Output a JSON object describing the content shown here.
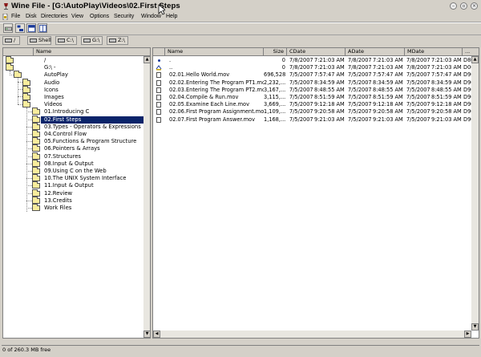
{
  "window": {
    "title": "Wine File - [G:\\AutoPlay\\Videos\\02.First Steps"
  },
  "menu": [
    "File",
    "Disk",
    "Directories",
    "View",
    "Options",
    "Security",
    "Window",
    "Help"
  ],
  "drives": [
    "/",
    "Shell",
    "C:\\",
    "G:\\",
    "Z:\\"
  ],
  "tree": {
    "header": "Name",
    "items": [
      {
        "label": "/",
        "level": 0
      },
      {
        "label": "G:\\ -",
        "level": 0
      },
      {
        "label": "AutoPlay",
        "level": 1
      },
      {
        "label": "Audio",
        "level": 2
      },
      {
        "label": "Icons",
        "level": 2
      },
      {
        "label": "Images",
        "level": 2
      },
      {
        "label": "Videos",
        "level": 2
      },
      {
        "label": "01.Introducing C",
        "level": 3
      },
      {
        "label": "02.First Steps",
        "level": 3,
        "selected": true
      },
      {
        "label": "03.Types - Operators & Expressions",
        "level": 3
      },
      {
        "label": "04.Control Flow",
        "level": 3
      },
      {
        "label": "05.Functions & Program Structure",
        "level": 3
      },
      {
        "label": "06.Pointers & Arrays",
        "level": 3
      },
      {
        "label": "07.Structures",
        "level": 3
      },
      {
        "label": "08.Input & Output",
        "level": 3
      },
      {
        "label": "09.Using C on the Web",
        "level": 3
      },
      {
        "label": "10.The UNIX System Interface",
        "level": 3
      },
      {
        "label": "11.Input & Output",
        "level": 3
      },
      {
        "label": "12.Review",
        "level": 3
      },
      {
        "label": "13.Credits",
        "level": 3
      },
      {
        "label": "Work Files",
        "level": 3
      }
    ]
  },
  "files": {
    "headers": {
      "name": "Name",
      "size": "Size",
      "cdate": "CDate",
      "adate": "ADate",
      "mdate": "MDate",
      "more": "..."
    },
    "rows": [
      {
        "icon": "dot",
        "name": ".",
        "size": "0",
        "cdate": "7/8/2007",
        "ctime": "7:21:03 AM",
        "adate": "7/8/2007",
        "atime": "7:21:03 AM",
        "mdate": "7/8/2007",
        "mtime": "7:21:03 AM",
        "attr": "D80"
      },
      {
        "icon": "up",
        "name": "..",
        "size": "0",
        "cdate": "7/8/2007",
        "ctime": "7:21:03 AM",
        "adate": "7/8/2007",
        "atime": "7:21:03 AM",
        "mdate": "7/8/2007",
        "mtime": "7:21:03 AM",
        "attr": "D00"
      },
      {
        "icon": "file",
        "name": "02.01.Hello World.mov",
        "size": "696,528",
        "cdate": "7/5/2007",
        "ctime": "7:57:47 AM",
        "adate": "7/5/2007",
        "atime": "7:57:47 AM",
        "mdate": "7/5/2007",
        "mtime": "7:57:47 AM",
        "attr": "D90"
      },
      {
        "icon": "file",
        "name": "02.02.Entering The Program PT1.mov",
        "size": "2,232,...",
        "cdate": "7/5/2007",
        "ctime": "8:34:59 AM",
        "adate": "7/5/2007",
        "atime": "8:34:59 AM",
        "mdate": "7/5/2007",
        "mtime": "8:34:59 AM",
        "attr": "D90"
      },
      {
        "icon": "file",
        "name": "02.03.Entering The Program PT2.mov",
        "size": "3,167,...",
        "cdate": "7/5/2007",
        "ctime": "8:48:55 AM",
        "adate": "7/5/2007",
        "atime": "8:48:55 AM",
        "mdate": "7/5/2007",
        "mtime": "8:48:55 AM",
        "attr": "D90"
      },
      {
        "icon": "file",
        "name": "02.04.Compile & Run.mov",
        "size": "3,115,...",
        "cdate": "7/5/2007",
        "ctime": "8:51:59 AM",
        "adate": "7/5/2007",
        "atime": "8:51:59 AM",
        "mdate": "7/5/2007",
        "mtime": "8:51:59 AM",
        "attr": "D90"
      },
      {
        "icon": "file",
        "name": "02.05.Examine Each Line.mov",
        "size": "3,669,...",
        "cdate": "7/5/2007",
        "ctime": "9:12:18 AM",
        "adate": "7/5/2007",
        "atime": "9:12:18 AM",
        "mdate": "7/5/2007",
        "mtime": "9:12:18 AM",
        "attr": "D90"
      },
      {
        "icon": "file",
        "name": "02.06.First Program Assignment.mov",
        "size": "1,109,...",
        "cdate": "7/5/2007",
        "ctime": "9:20:58 AM",
        "adate": "7/5/2007",
        "atime": "9:20:58 AM",
        "mdate": "7/5/2007",
        "mtime": "9:20:58 AM",
        "attr": "D90"
      },
      {
        "icon": "file",
        "name": "02.07.First Program Answer.mov",
        "size": "1,168,...",
        "cdate": "7/5/2007",
        "ctime": "9:21:03 AM",
        "adate": "7/5/2007",
        "atime": "9:21:03 AM",
        "mdate": "7/5/2007",
        "mtime": "9:21:03 AM",
        "attr": "D90"
      }
    ]
  },
  "status": {
    "text": "0 of 260.3 MB free"
  }
}
